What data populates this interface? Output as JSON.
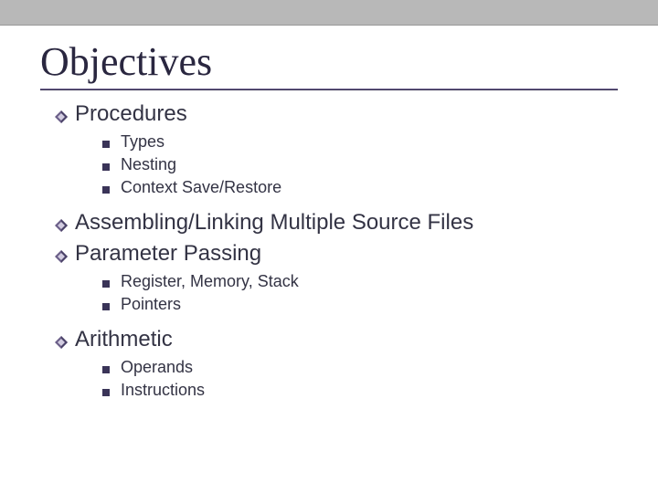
{
  "title": "Objectives",
  "items": [
    {
      "label": "Procedures",
      "sub": [
        "Types",
        "Nesting",
        "Context Save/Restore"
      ]
    },
    {
      "label": "Assembling/Linking Multiple Source Files",
      "sub": []
    },
    {
      "label": "Parameter Passing",
      "sub": [
        "Register, Memory, Stack",
        "Pointers"
      ]
    },
    {
      "label": "Arithmetic",
      "sub": [
        "Operands",
        "Instructions"
      ]
    }
  ]
}
